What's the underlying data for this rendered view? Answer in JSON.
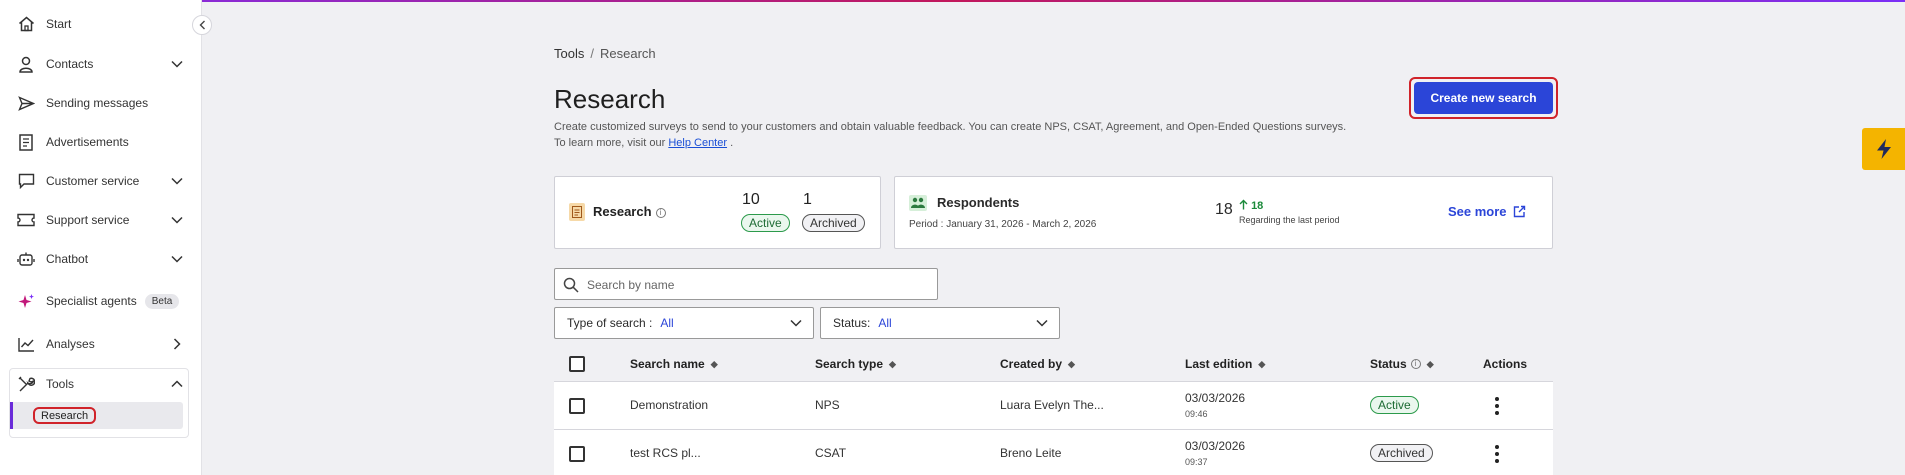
{
  "sidebar": {
    "items": [
      {
        "label": "Start",
        "icon": "home-icon"
      },
      {
        "label": "Contacts",
        "icon": "person-icon"
      },
      {
        "label": "Sending messages",
        "icon": "send-icon"
      },
      {
        "label": "Advertisements",
        "icon": "document-icon"
      },
      {
        "label": "Customer service",
        "icon": "chat-icon"
      },
      {
        "label": "Support service",
        "icon": "ticket-icon"
      },
      {
        "label": "Chatbot",
        "icon": "robot-icon"
      },
      {
        "label": "Specialist agents",
        "icon": "sparkle-icon",
        "badge": "Beta"
      },
      {
        "label": "Analyses",
        "icon": "chart-icon"
      },
      {
        "label": "Tools",
        "icon": "tools-icon"
      }
    ],
    "sub_item": "Research"
  },
  "breadcrumb": {
    "root": "Tools",
    "separator": "/",
    "current": "Research"
  },
  "page": {
    "title": "Research",
    "description_line1": "Create customized surveys to send to your customers and obtain valuable feedback. You can create NPS, CSAT, Agreement, and Open-Ended Questions surveys.",
    "description_line2_prefix": "To learn more, visit our",
    "help_link": "Help Center",
    "description_line2_suffix": ".",
    "create_button": "Create new search"
  },
  "stats": {
    "research_label": "Research",
    "active_count": "10",
    "active_label": "Active",
    "archived_count": "1",
    "archived_label": "Archived",
    "respondents_label": "Respondents",
    "period": "Period : January 31, 2026 - March 2, 2026",
    "respondents_count": "18",
    "delta": "18",
    "regarding": "Regarding the last period",
    "see_more": "See more"
  },
  "filters": {
    "search_placeholder": "Search by name",
    "type_label": "Type of search :",
    "type_value": "All",
    "status_label": "Status:",
    "status_value": "All"
  },
  "table": {
    "columns": [
      "Search name",
      "Search type",
      "Created by",
      "Last edition",
      "Status",
      "Actions"
    ],
    "rows": [
      {
        "name": "Demonstration",
        "type": "NPS",
        "created_by": "Luara Evelyn The...",
        "date": "03/03/2026",
        "time": "09:46",
        "status": "Active"
      },
      {
        "name": "test RCS pl...",
        "type": "CSAT",
        "created_by": "Breno Leite",
        "date": "03/03/2026",
        "time": "09:37",
        "status": "Archived"
      }
    ]
  },
  "colors": {
    "primary": "#2b45d8",
    "highlight": "#d0232a",
    "active_green": "#2c9a4b",
    "accent_purple": "#6a2bd9",
    "bolt": "#f4b400"
  }
}
